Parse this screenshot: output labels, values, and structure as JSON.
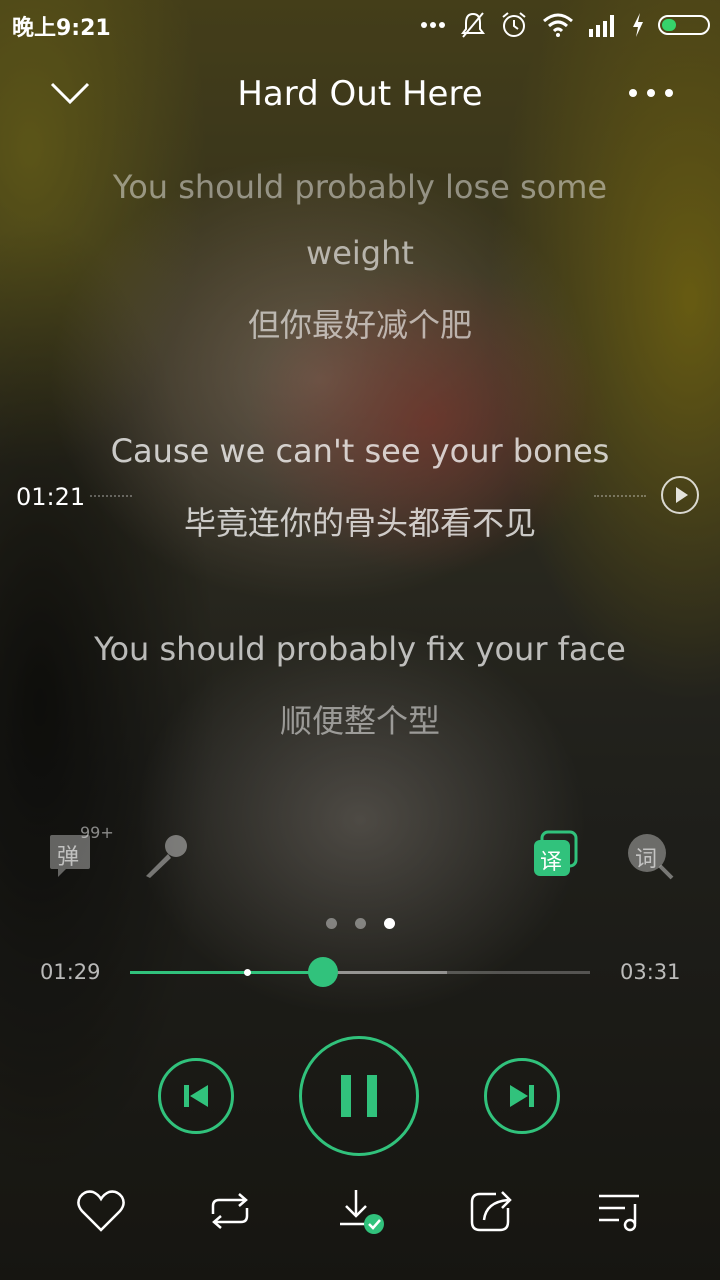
{
  "status_bar": {
    "time": "晚上9:21",
    "icons": [
      "more-dots-icon",
      "notifications-off-icon",
      "alarm-icon",
      "wifi-icon",
      "signal-icon",
      "charging-icon",
      "battery-icon"
    ]
  },
  "header": {
    "title": "Hard Out Here",
    "back_icon": "chevron-down-icon",
    "more_icon": "more-icon"
  },
  "lyrics": {
    "lines": [
      {
        "en_line1": "You should probably lose some",
        "en_line2": "weight",
        "cn": "但你最好减个肥"
      },
      {
        "en": "Cause we can't see your bones",
        "cn": "毕竟连你的骨头都看不见"
      },
      {
        "en": "You should probably fix your face",
        "cn": "顺便整个型"
      }
    ],
    "seek_time": "01:21"
  },
  "tools": {
    "danmaku_label": "弹",
    "danmaku_badge": "99+",
    "translate_label": "译",
    "lyrics_search_label": "词"
  },
  "pager": {
    "count": 3,
    "active_index": 2
  },
  "progress": {
    "current": "01:29",
    "total": "03:31",
    "played_fraction": 0.42,
    "buffered_fraction": 0.69,
    "marker_fraction": 0.255
  },
  "colors": {
    "accent": "#31c27c"
  },
  "controls": [
    "previous-icon",
    "pause-icon",
    "next-icon"
  ],
  "bottom_bar": [
    "heart-icon",
    "repeat-icon",
    "download-done-icon",
    "share-icon",
    "playlist-icon"
  ]
}
